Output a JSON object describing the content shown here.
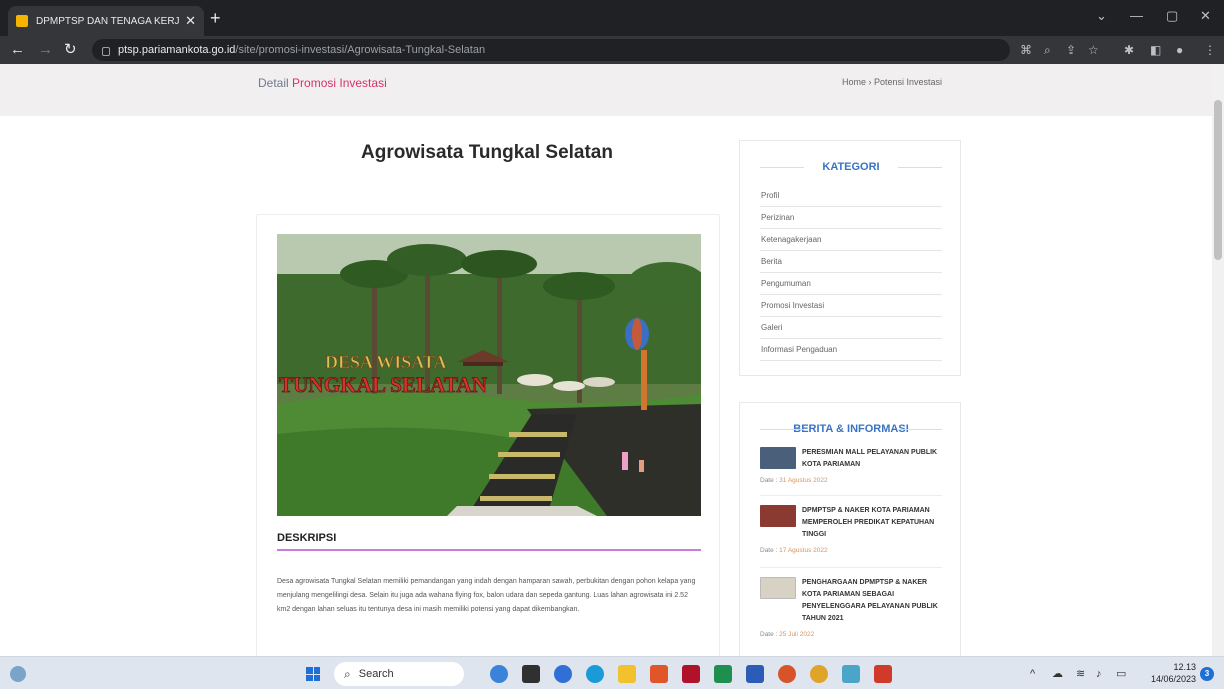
{
  "browser": {
    "tab_title": "DPMPTSP DAN TENAGA KERJA K",
    "new_tab_label": "+",
    "url_host": "ptsp.pariamankota.go.id",
    "url_path": "/site/promosi-investasi/Agrowisata-Tungkal-Selatan"
  },
  "header": {
    "title_part1": "Detail",
    "title_part2": "Promosi Investasi",
    "breadcrumb": "Home  ›  Potensi Investasi"
  },
  "article": {
    "title": "Agrowisata Tungkal Selatan",
    "photo_caption_line1": "DESA WISATA",
    "photo_caption_line2": "TUNGKAL SELATAN",
    "desc_heading": "DESKRIPSI",
    "desc_text": "Desa agrowisata Tungkal Selatan memiliki pemandangan yang indah dengan hamparan sawah, perbukitan dengan pohon kelapa yang menjulang mengelilingi desa. Selain itu juga ada wahana flying fox, balon udara dan sepeda gantung. Luas lahan agrowisata ini 2.52 km2 dengan lahan seluas itu tentunya desa ini masih memiliki potensi yang dapat dikembangkan."
  },
  "kategori": {
    "title": "KATEGORI",
    "items": [
      "Profil",
      "Perizinan",
      "Ketenagakerjaan",
      "Berita",
      "Pengumuman",
      "Promosi Investasi",
      "Galeri",
      "Informasi Pengaduan"
    ]
  },
  "berita": {
    "title": "BERITA & INFORMASI",
    "date_prefix": "Date : ",
    "items": [
      {
        "headline": "PERESMIAN MALL PELAYANAN PUBLIK KOTA PARIAMAN",
        "date": "31 Agustus 2022"
      },
      {
        "headline": "DPMPTSP & NAKER KOTA PARIAMAN MEMPEROLEH PREDIKAT KEPATUHAN TINGGI",
        "date": "17 Agustus 2022"
      },
      {
        "headline": "PENGHARGAAN DPMPTSP & NAKER KOTA PARIAMAN SEBAGAI PENYELENGGARA PELAYANAN PUBLIK TAHUN 2021",
        "date": "25 Juli 2022"
      }
    ]
  },
  "taskbar": {
    "search_label": "Search",
    "time": "12.13",
    "date": "14/06/2023",
    "notification_count": "3"
  }
}
